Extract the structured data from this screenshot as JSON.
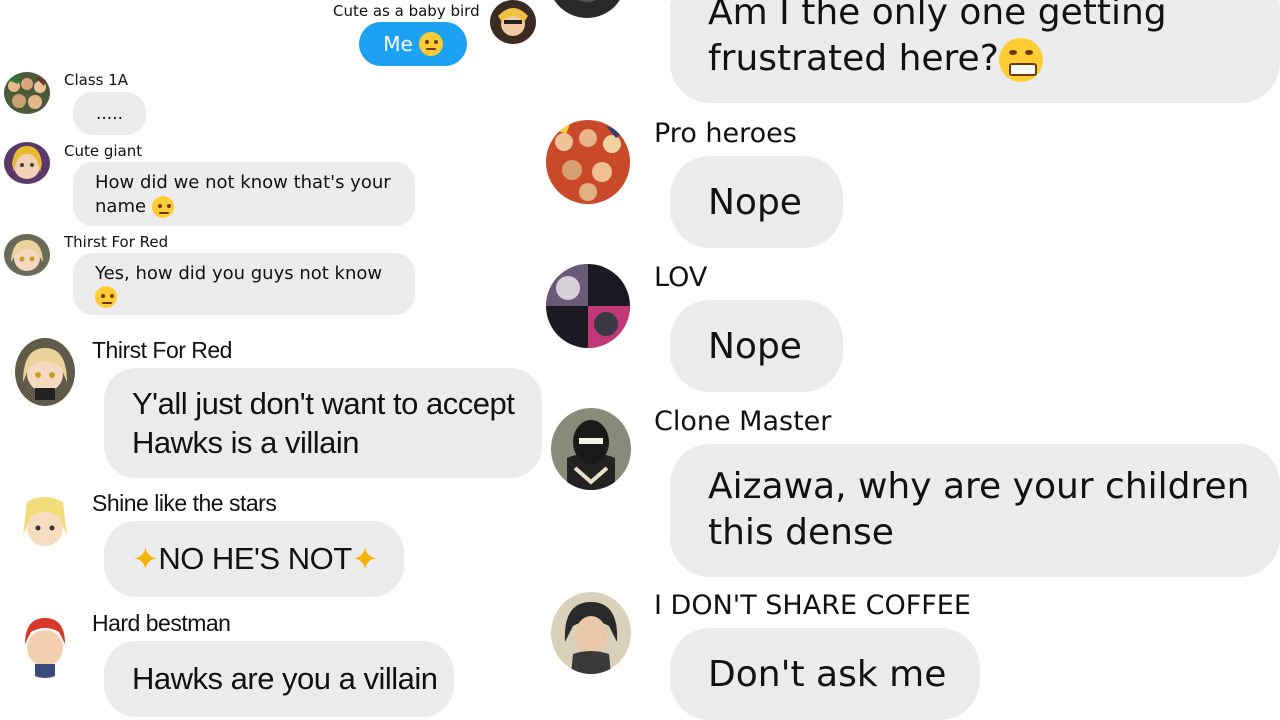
{
  "left": {
    "me_message": {
      "sender": "Cute as a baby bird",
      "text": "Me",
      "emoji": "smiling-face-icon",
      "bubble_color": "#1da1f2"
    },
    "messages": [
      {
        "sender": "Class 1A",
        "text": "....."
      },
      {
        "sender": "Cute giant",
        "text": "How did we not know that's your name",
        "emoji": "confused-face-icon"
      },
      {
        "sender": "Thirst For Red",
        "text": "Yes, how did you guys not know",
        "emoji": "confused-face-icon"
      },
      {
        "sender": "Thirst For Red",
        "text": "Y'all just don't want to accept Hawks is a villain"
      },
      {
        "sender": "Shine like the stars",
        "text": "NO HE'S NOT",
        "emoji": "sparkles-icon"
      },
      {
        "sender": "Hard bestman",
        "text": "Hawks are you a villain"
      }
    ]
  },
  "right": {
    "messages": [
      {
        "sender": "",
        "text": "Am I the only one getting frustrated here?",
        "emoji": "grimacing-face-icon"
      },
      {
        "sender": "Pro heroes",
        "text": "Nope"
      },
      {
        "sender": "LOV",
        "text": "Nope"
      },
      {
        "sender": "Clone Master",
        "text": "Aizawa, why are your children this dense"
      },
      {
        "sender": "I DON'T SHARE COFFEE",
        "text": "Don't ask me"
      }
    ]
  },
  "colors": {
    "bubble_gray": "#ebebeb",
    "me_bubble": "#1da1f2",
    "background": "#ffffff"
  }
}
